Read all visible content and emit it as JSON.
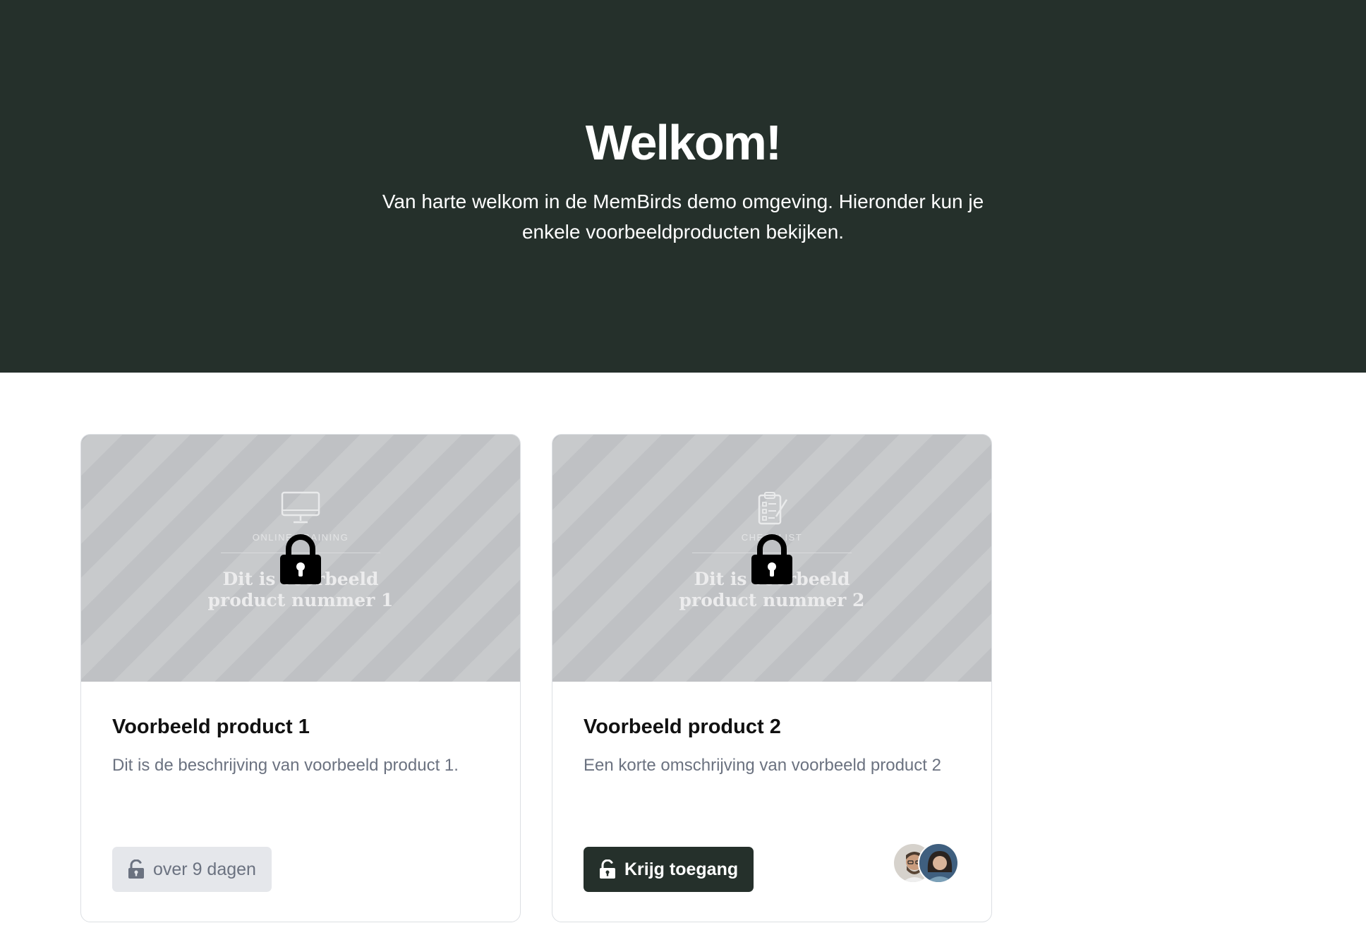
{
  "hero": {
    "title": "Welkom!",
    "subtitle": "Van harte welkom in de MemBirds demo omgeving. Hieronder kun je enkele voorbeeldproducten bekijken."
  },
  "products": [
    {
      "thumb_kicker": "ONLINE TRAINING",
      "thumb_title_1": "Dit is voorbeeld",
      "thumb_title_2": "product nummer 1",
      "thumb_icon": "monitor-icon",
      "title": "Voorbeeld product 1",
      "description": "Dit is de beschrijving van voorbeeld product 1.",
      "button_label": "over 9 dagen",
      "locked": true
    },
    {
      "thumb_kicker": "CHECKLIST",
      "thumb_title_1": "Dit is voorbeeld",
      "thumb_title_2": "product nummer 2",
      "thumb_icon": "clipboard-checklist-icon",
      "title": "Voorbeeld product 2",
      "description": "Een korte omschrijving van voorbeeld product 2",
      "button_label": "Krijg toegang",
      "locked": true
    }
  ],
  "colors": {
    "hero_bg": "#25302b",
    "primary_button": "#25302b",
    "muted_text": "#6b7280",
    "disabled_button": "#e5e7eb"
  }
}
